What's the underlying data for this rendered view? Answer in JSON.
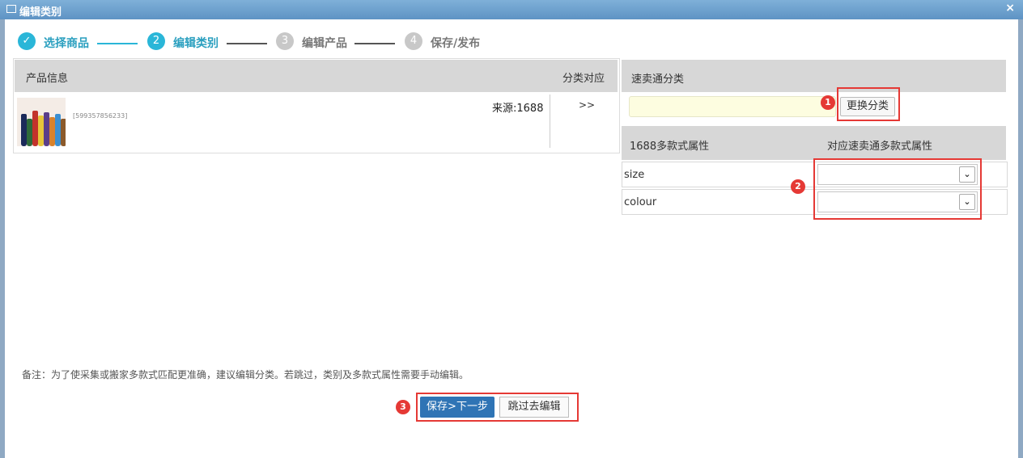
{
  "window": {
    "title": "编辑类别",
    "close": "×"
  },
  "steps": [
    {
      "num": "✓",
      "label": "选择商品",
      "state": "done"
    },
    {
      "num": "2",
      "label": "编辑类别",
      "state": "active"
    },
    {
      "num": "3",
      "label": "编辑产品",
      "state": "todo"
    },
    {
      "num": "4",
      "label": "保存/发布",
      "state": "todo"
    }
  ],
  "left": {
    "col_product": "产品信息",
    "col_mapping": "分类对应",
    "product": {
      "id": "[599357856233]",
      "source": "来源:1688",
      "arrow": ">>"
    }
  },
  "right": {
    "category_header": "速卖通分类",
    "category_value": "",
    "change_button": "更换分类",
    "attr_col1": "1688多款式属性",
    "attr_col2": "对应速卖通多款式属性",
    "attributes": [
      {
        "name": "size",
        "selected": ""
      },
      {
        "name": "colour",
        "selected": ""
      }
    ]
  },
  "note": "备注：为了使采集或搬家多款式匹配更准确，建议编辑分类。若跳过，类别及多款式属性需要手动编辑。",
  "buttons": {
    "save_next": "保存>下一步",
    "skip": "跳过去编辑"
  },
  "badges": [
    "1",
    "2",
    "3"
  ],
  "colors": {
    "accent": "#2ab6d8",
    "primary_button": "#2f74b5",
    "highlight": "#e53935",
    "title_bar": "#5e93c4"
  }
}
